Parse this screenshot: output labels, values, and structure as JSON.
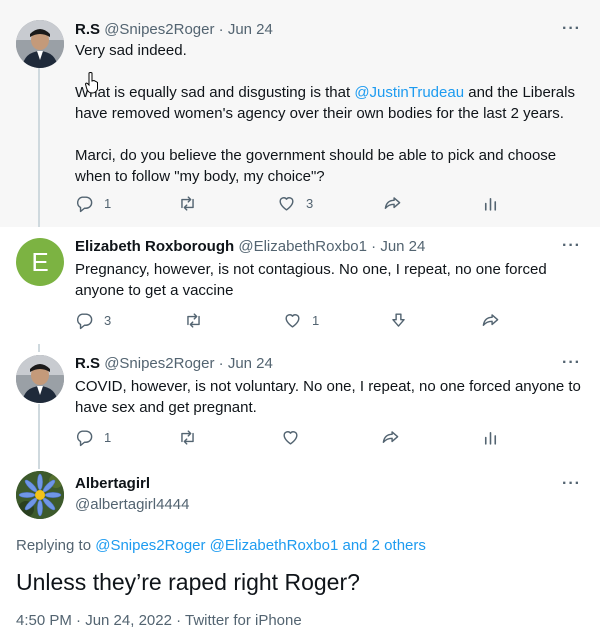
{
  "tweets": [
    {
      "name": "R.S",
      "handle": "@Snipes2Roger",
      "dot": "·",
      "date": "Jun 24",
      "more": "···",
      "lines": [
        "Very sad indeed.",
        "What is equally sad and disgusting is that",
        "@JustinTrudeau",
        " and the Liberals have removed women's agency over their own bodies for the last 2 years.",
        "Marci, do you believe the government should be able to pick and choose when to follow \"my body, my choice\"?"
      ],
      "reply_count": "1",
      "retweet_count": "",
      "like_count": "3"
    },
    {
      "name": "Elizabeth Roxborough",
      "handle": "@ElizabethRoxbo1",
      "dot": "·",
      "date": "Jun 24",
      "more": "···",
      "avatar_letter": "E",
      "text": "Pregnancy, however, is not contagious. No one, I repeat, no one forced anyone to get a vaccine",
      "reply_count": "3",
      "retweet_count": "",
      "like_count": "1"
    },
    {
      "name": "R.S",
      "handle": "@Snipes2Roger",
      "dot": "·",
      "date": "Jun 24",
      "more": "···",
      "text": "COVID, however, is not voluntary. No one, I repeat, no one forced anyone to have sex and get pregnant.",
      "reply_count": "1",
      "retweet_count": "",
      "like_count": ""
    }
  ],
  "main": {
    "name": "Albertagirl",
    "handle": "@albertagirl4444",
    "more": "···",
    "replying_prefix": "Replying to",
    "replying_mentions": "@Snipes2Roger @ElizabethRoxbo1 and 2 others",
    "text": "Unless they’re raped right Roger?",
    "timestamp": "4:50 PM · Jun 24, 2022 · Twitter for iPhone"
  },
  "colors": {
    "accent": "#1d9bf0",
    "muted": "#536471",
    "avatar_e": "#7cb342"
  }
}
